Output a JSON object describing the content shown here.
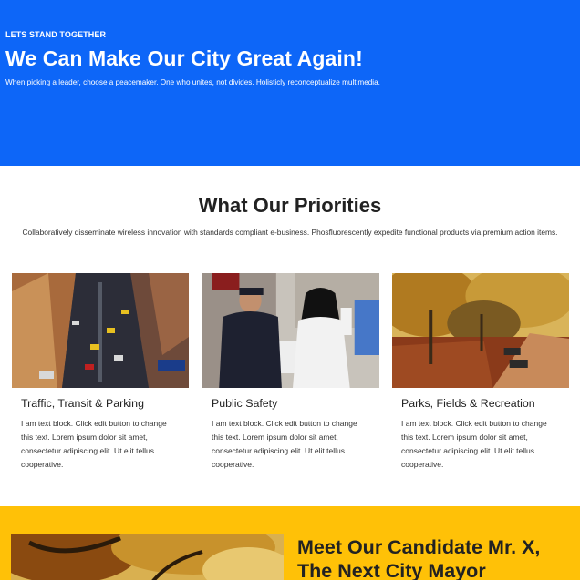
{
  "hero": {
    "kicker": "LETS STAND TOGETHER",
    "headline": "We Can Make Our City Great Again!",
    "lead": "When picking a leader, choose a peacemaker. One who unites, not divides. Holisticly reconceptualize multimedia.",
    "bg_color": "#0d66f8"
  },
  "priorities": {
    "title": "What Our Priorities",
    "description": "Collaboratively disseminate wireless innovation with standards compliant e-business. Phosfluorescently expedite functional products via premium action items.",
    "cards": [
      {
        "title": "Traffic, Transit & Parking",
        "body": "I am text block. Click edit button to change this text. Lorem ipsum dolor sit amet, consectetur adipiscing elit. Ut elit tellus cooperative.",
        "image": "city-traffic-aerial-photo"
      },
      {
        "title": "Public Safety",
        "body": "I am text block. Click edit button to change this text. Lorem ipsum dolor sit amet, consectetur adipiscing elit. Ut elit tellus cooperative.",
        "image": "police-officer-street-photo"
      },
      {
        "title": "Parks, Fields & Recreation",
        "body": "I am text block. Click edit button to change this text. Lorem ipsum dolor sit amet, consectetur adipiscing elit. Ut elit tellus cooperative.",
        "image": "autumn-park-path-photo"
      }
    ]
  },
  "candidate": {
    "title": "Meet Our Candidate Mr. X, The Next City Mayor",
    "bg_color": "#ffc107",
    "image": "autumn-trees-photo"
  }
}
